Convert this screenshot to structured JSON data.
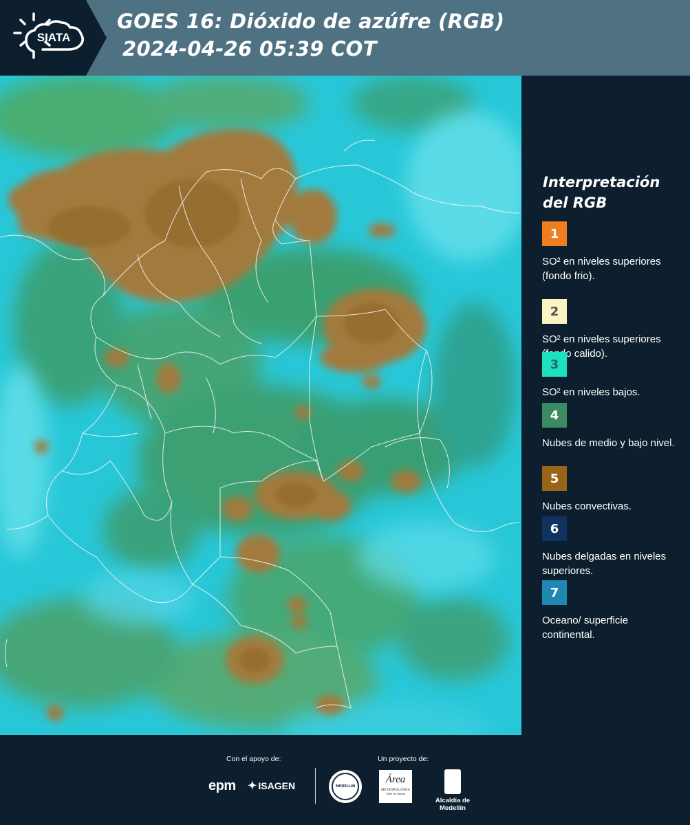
{
  "header": {
    "logo_text": "SIATA",
    "title_line1": "GOES 16: Dióxido de azúfre (RGB)",
    "title_line2": "2024-04-26 05:39 COT"
  },
  "legend": {
    "title_line1": "Interpretación",
    "title_line2": "del RGB",
    "items": [
      {
        "number": "1",
        "color": "#f07d1e",
        "text_color": "#ffffff",
        "label": "SO² en niveles superiores (fondo frio)."
      },
      {
        "number": "2",
        "color": "#fbf3c2",
        "text_color": "#555555",
        "label": "SO² en niveles superiores (fondo calido)."
      },
      {
        "number": "3",
        "color": "#1ee0c0",
        "text_color": "#1f6b60",
        "label": "SO² en niveles bajos."
      },
      {
        "number": "4",
        "color": "#3c8a62",
        "text_color": "#ffffff",
        "label": "Nubes de medio y bajo nivel."
      },
      {
        "number": "5",
        "color": "#9a6418",
        "text_color": "#ffffff",
        "label": "Nubes convectivas."
      },
      {
        "number": "6",
        "color": "#10325e",
        "text_color": "#ffffff",
        "label": "Nubes delgadas en niveles superiores."
      },
      {
        "number": "7",
        "color": "#1e88b2",
        "text_color": "#ffffff",
        "label": "Oceano/ superficie continental."
      }
    ]
  },
  "footer": {
    "support_caption": "Con el apoyo de:",
    "project_caption": "Un proyecto de:",
    "sponsor1": "epm",
    "sponsor2": "ISAGEN",
    "partner1": "MEDELLIN",
    "partner2_title": "Área",
    "partner2_sub": "METROPOLITANA",
    "partner2_sub2": "Valle de Aburrá",
    "partner3": "Alcaldía de Medellín"
  }
}
